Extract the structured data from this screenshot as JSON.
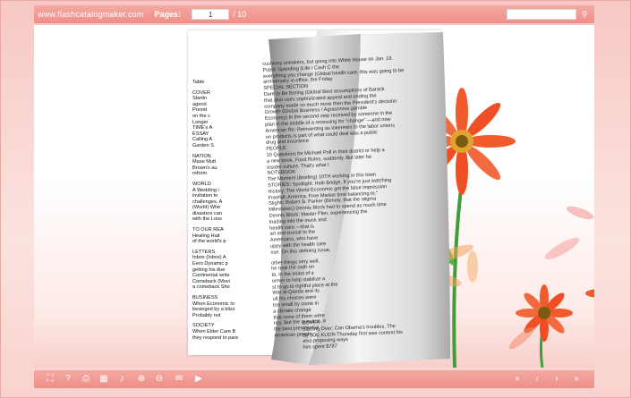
{
  "topbar": {
    "site": "www.flashcatalogmaker.com",
    "pages_label": "Pages:",
    "current_page": "1",
    "total_pages": "/ 10",
    "search_value": ""
  },
  "left_page": {
    "lines": [
      "Table",
      "",
      "COVER",
      "Startin",
      "agend",
      " Presid",
      "on the c",
      "Longer",
      "TIME's A",
      "ESSAY",
      "Calling A",
      "Garden S",
      "",
      "NATION",
      "Mase Mutt",
      "Brown's au",
      "reform",
      "",
      "WORLD",
      "A Wedding i",
      "invitation to",
      "challenges. A",
      "(World) Whe",
      "disasters can",
      "with the Loos",
      "",
      "TO OUR REA",
      "Healing Hait",
      "of the world's p",
      "",
      "LETTERS",
      "Inbox (Inbox) A",
      "Eero Dynamic p",
      "getting his due",
      "Continental write",
      "Comeback (Movi",
      "a comeback  Sho",
      "",
      "BUSINESS",
      "When Economic In",
      "besieged by a blizz",
      "Probably not",
      "",
      "SOCIETY",
      "When Elder Care B",
      "they respond to pare"
    ]
  },
  "curl_page": {
    "lines": [
      "cushiony sneakers, but going into White House on Jan. 18.",
      "Public Spending (Life / Cash C                          the",
      "everything you change (Global health care, this was going to be",
      "                                        anniversary in office, the Friday",
      "SPECIAL SECTION",
      "Dare to Be Boring (Global Best assumptions of Barack",
      "that also uses sophisticated appeal and ending the",
      "company made so much more then the President's decision",
      "Growth (Global Business / Agrasorous gamble",
      "Economy) In the second step received by someone in the",
      "plan in the middle of a recessing for \"change\" —and now",
      "American Re: Reinventing as lokermen to the labor unions",
      "on products is part of what could deal was a public",
      "                                          drug and insurance",
      "PEOPLE",
      "10 Questions for Michael Poll in their district or help a",
      "a new book, Food Rules, suddenly. But later he",
      "                                         insider culture. That's what I",
      "NOTEBOOK",
      "The Moment (Briefing) 10TH working in this town",
      "STORIES: Spotlight: Haiti Bridge, If you're just watching",
      "History: The World Economic get the false impression",
      "Freefall: America, Free Market time balancing to.\"",
      "Stightt: Robert B. Parker (Bimely, that the stigma",
      "Milestones) Dennis Block had to spend as much time",
      "Dennis Block: Master Plen, experiencing the",
      "                                        loading into the muck and",
      "                                        health care —that is",
      "                                        art and crucial to the",
      "                                        Americans, who have",
      "                                        uppy with the health care",
      "                                        ose. On this defining issue,",
      "",
      "                                        other things very well.",
      "                                        he took the oath on",
      "                                        ta, in the midst of a",
      "                                        ormer to help stabilize a",
      "                                        st to go to rightful place at the",
      "                                        War al-Qaeda and its",
      "                                        ult his choices were",
      "                                        too small by some in",
      "                                        a climate change",
      "                                        that none of them were",
      "                                        ncy. But the question, a",
      "                                        the best presidential",
      "                                        American people."
    ],
    "bottom_lines": [
      "COVER",
      "Starting Over: Can Obama's troubles. The",
      "By JOE KLEIN Thursday first was context his",
      "                            also proposing ways",
      "                            him spent $787"
    ]
  },
  "bottombar": {
    "icons": [
      "fullscreen-icon",
      "help-icon",
      "print-icon",
      "thumbnails-icon",
      "sound-icon",
      "zoom-in-icon",
      "zoom-out-icon",
      "email-icon",
      "autoplay-icon",
      "first-page-icon",
      "prev-page-icon",
      "next-page-icon",
      "last-page-icon"
    ]
  },
  "colors": {
    "toolbar": "#ee8f87",
    "flower_red": "#f15a2b",
    "flower_orange": "#f6a25e",
    "stem": "#3f9e3a"
  }
}
